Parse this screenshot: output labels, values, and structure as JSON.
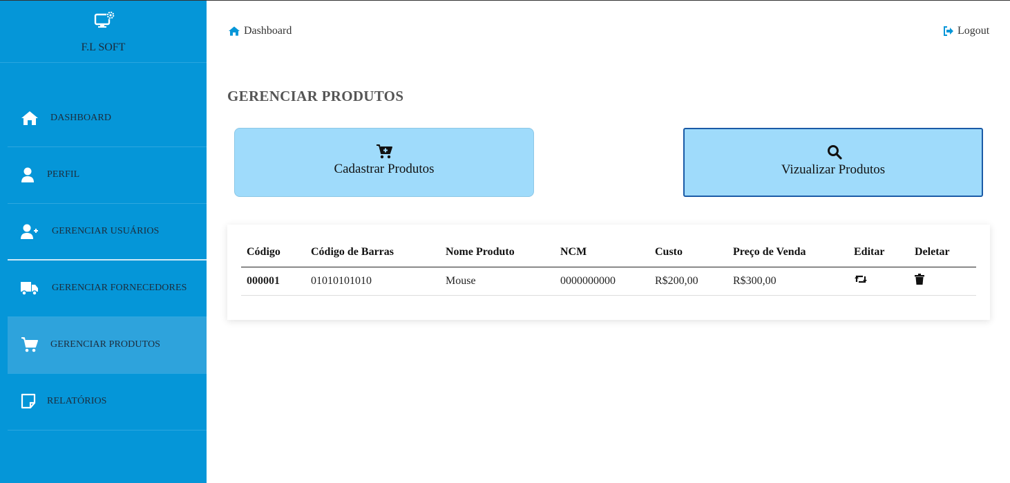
{
  "brand": {
    "name": "F.L SOFT",
    "icon": "monitor-gear-icon"
  },
  "sidebar": {
    "items": [
      {
        "label": "DASHBOARD",
        "icon": "home-icon"
      },
      {
        "label": "PERFIL",
        "icon": "user-icon"
      },
      {
        "label": "GERENCIAR USUÁRIOS",
        "icon": "user-plus-icon"
      },
      {
        "label": "GERENCIAR FORNECEDORES",
        "icon": "truck-icon"
      },
      {
        "label": "GERENCIAR PRODUTOS",
        "icon": "cart-icon",
        "active": true
      },
      {
        "label": "RELATÓRIOS",
        "icon": "note-icon"
      }
    ]
  },
  "topbar": {
    "breadcrumb": "Dashboard",
    "logout": "Logout"
  },
  "page": {
    "title": "GERENCIAR PRODUTOS",
    "actions": [
      {
        "label": "Cadastrar Produtos",
        "icon": "cart-plus-icon"
      },
      {
        "label": "Vizualizar Produtos",
        "icon": "search-icon"
      }
    ]
  },
  "table": {
    "headers": [
      "Código",
      "Código de Barras",
      "Nome Produto",
      "NCM",
      "Custo",
      "Preço de Venda",
      "Editar",
      "Deletar"
    ],
    "rows": [
      {
        "codigo": "000001",
        "barras": "01010101010",
        "nome": "Mouse",
        "ncm": "0000000000",
        "custo": "R$200,00",
        "venda": "R$300,00",
        "edit_icon": "retweet-icon",
        "delete_icon": "trash-icon"
      }
    ]
  },
  "colors": {
    "sidebar": "#0596d8",
    "button": "#9fdbfb",
    "accent": "#0596d8"
  }
}
